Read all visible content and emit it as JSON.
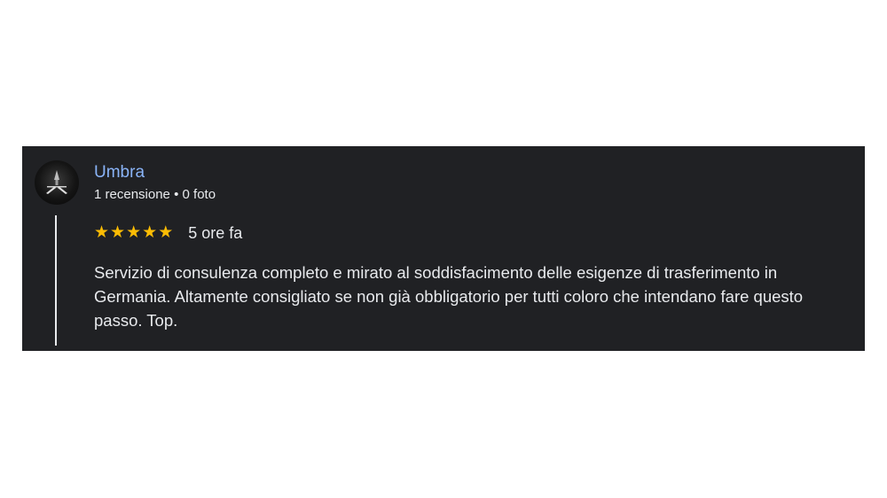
{
  "review": {
    "author": {
      "name": "Umbra",
      "reviews_count": "1 recensione",
      "separator": "•",
      "photos_count": "0 foto",
      "avatar_icon": "dark-logo-avatar-icon"
    },
    "rating": {
      "value": 5,
      "max": 5,
      "star_symbol": "★",
      "star_color": "#fbbc04"
    },
    "time": "5 ore fa",
    "text": "Servizio di consulenza completo e mirato al soddisfacimento delle esigenze di trasferimento in Germania. Altamente consigliato se non già obbligatorio per tutti coloro che intendano fare questo passo. Top."
  },
  "colors": {
    "card_background": "#202124",
    "author_link": "#8ab4f8",
    "text": "#e8eaed"
  }
}
